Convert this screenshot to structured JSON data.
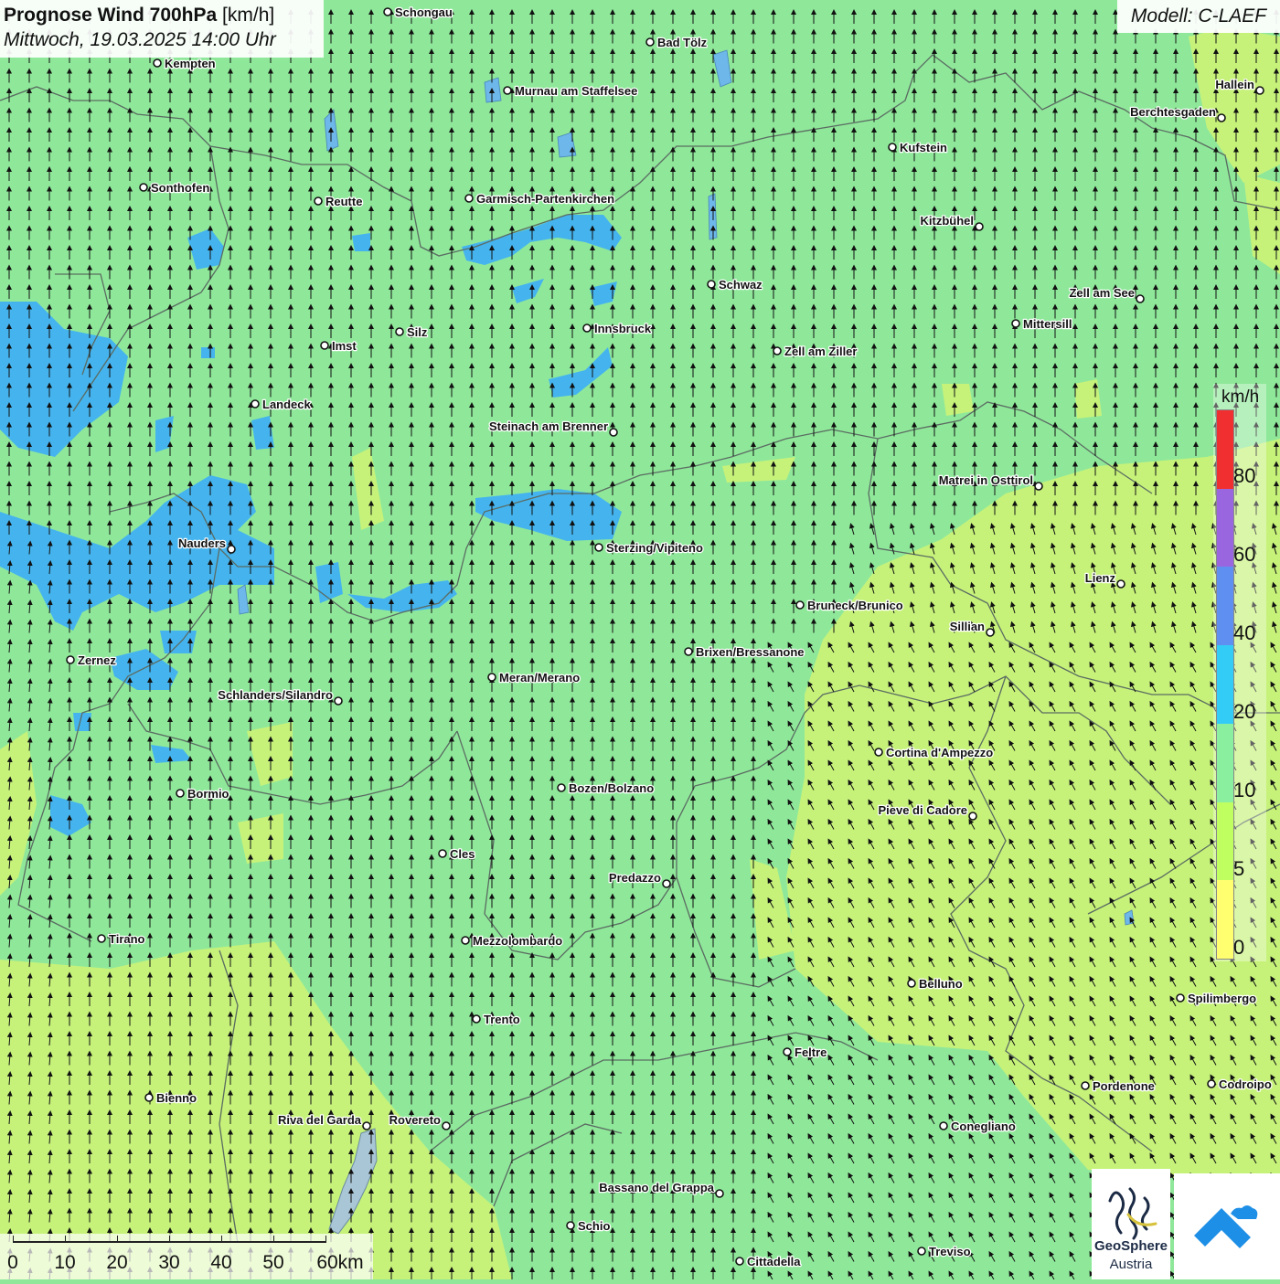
{
  "header": {
    "title": "Prognose Wind 700hPa",
    "unit": "[km/h]",
    "datetime": "Mittwoch, 19.03.2025 14:00 Uhr",
    "model": "Modell: C-LAEF"
  },
  "legend": {
    "unit": "km/h",
    "ticks": [
      "80",
      "60",
      "40",
      "20",
      "10",
      "5",
      "0"
    ],
    "colors": [
      "#f03030",
      "#9966e0",
      "#5f8ff0",
      "#33ccf6",
      "#8af0a0",
      "#c0ff60",
      "#ffff70"
    ]
  },
  "scale_bar": {
    "labels": [
      "0",
      "10",
      "20",
      "30",
      "40",
      "50",
      "60km"
    ]
  },
  "logos": {
    "geosphere_line1": "GeoSphere",
    "geosphere_line2": "Austria"
  },
  "cities": [
    {
      "name": "Schongau"
    },
    {
      "name": "Kempten"
    },
    {
      "name": "Bad Tölz"
    },
    {
      "name": "Murnau am Staffelsee"
    },
    {
      "name": "Hallein"
    },
    {
      "name": "Berchtesgaden"
    },
    {
      "name": "Kufstein"
    },
    {
      "name": "Sonthofen"
    },
    {
      "name": "Reutte"
    },
    {
      "name": "Garmisch-Partenkirchen"
    },
    {
      "name": "Kitzbühel"
    },
    {
      "name": "Schwaz"
    },
    {
      "name": "Zell am See"
    },
    {
      "name": "Mittersill"
    },
    {
      "name": "Silz"
    },
    {
      "name": "Innsbruck"
    },
    {
      "name": "Imst"
    },
    {
      "name": "Zell am Ziller"
    },
    {
      "name": "Landeck"
    },
    {
      "name": "Steinach am Brenner"
    },
    {
      "name": "Matrei in Osttirol"
    },
    {
      "name": "Nauders"
    },
    {
      "name": "Sterzing/Vipiteno"
    },
    {
      "name": "Lienz"
    },
    {
      "name": "Bruneck/Brunico"
    },
    {
      "name": "Sillian"
    },
    {
      "name": "Brixen/Bressanone"
    },
    {
      "name": "Zernez"
    },
    {
      "name": "Meran/Merano"
    },
    {
      "name": "Schlanders/Silandro"
    },
    {
      "name": "Cortina d'Ampezzo"
    },
    {
      "name": "Bozen/Bolzano"
    },
    {
      "name": "Bormio"
    },
    {
      "name": "Pieve di Cadore"
    },
    {
      "name": "Cles"
    },
    {
      "name": "Predazzo"
    },
    {
      "name": "Tirano"
    },
    {
      "name": "Mezzolombardo"
    },
    {
      "name": "Belluno"
    },
    {
      "name": "Spilimbergo"
    },
    {
      "name": "Trento"
    },
    {
      "name": "Feltre"
    },
    {
      "name": "Pordenone"
    },
    {
      "name": "Codroipo"
    },
    {
      "name": "Bienno"
    },
    {
      "name": "Riva del Garda"
    },
    {
      "name": "Rovereto"
    },
    {
      "name": "Conegliano"
    },
    {
      "name": "Bassano del Grappa"
    },
    {
      "name": "Schio"
    },
    {
      "name": "Treviso"
    },
    {
      "name": "Cittadella"
    }
  ]
}
